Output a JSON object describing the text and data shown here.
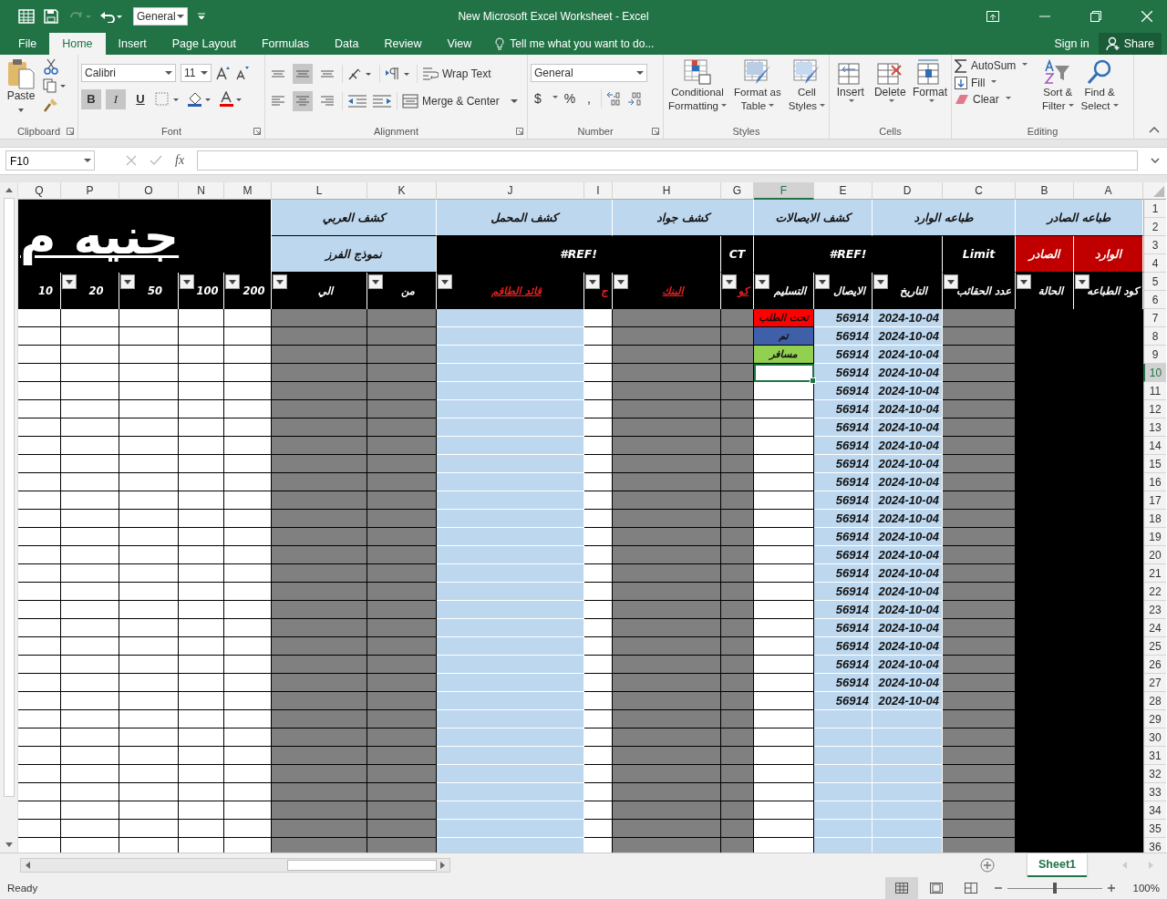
{
  "window": {
    "title": "New Microsoft Excel Worksheet - Excel",
    "quick_format": "General"
  },
  "ribbon": {
    "tabs": [
      {
        "label": "File",
        "selected": false
      },
      {
        "label": "Home",
        "selected": true
      },
      {
        "label": "Insert",
        "selected": false
      },
      {
        "label": "Page Layout",
        "selected": false
      },
      {
        "label": "Formulas",
        "selected": false
      },
      {
        "label": "Data",
        "selected": false
      },
      {
        "label": "Review",
        "selected": false
      },
      {
        "label": "View",
        "selected": false
      }
    ],
    "tell_me": "Tell me what you want to do...",
    "sign_in": "Sign in",
    "share": "Share",
    "clipboard": {
      "paste": "Paste",
      "label": "Clipboard"
    },
    "font": {
      "name": "Calibri",
      "size": "11",
      "label": "Font",
      "buttons": [
        {
          "label": "B",
          "selected": true
        },
        {
          "label": "I",
          "selected": true
        },
        {
          "label": "U",
          "selected": false
        }
      ]
    },
    "alignment": {
      "label": "Alignment",
      "wrap": "Wrap Text",
      "merge": "Merge & Center",
      "vertical": [
        {
          "selected": false
        },
        {
          "selected": true
        },
        {
          "selected": false
        }
      ],
      "horizontal": [
        {
          "selected": false
        },
        {
          "selected": true
        },
        {
          "selected": false
        }
      ]
    },
    "number": {
      "label": "Number",
      "format": "General",
      "currency": "$",
      "percent": "%",
      "comma": ","
    },
    "styles": {
      "label": "Styles",
      "buttons": [
        [
          "Conditional",
          "Formatting"
        ],
        [
          "Format as",
          "Table"
        ],
        [
          "Cell",
          "Styles"
        ]
      ]
    },
    "cells": {
      "label": "Cells",
      "buttons": [
        "Insert",
        "Delete",
        "Format"
      ]
    },
    "editing": {
      "label": "Editing",
      "autosum": "AutoSum",
      "fill": "Fill",
      "clear": "Clear",
      "sort": [
        "Sort &",
        "Filter"
      ],
      "find": [
        "Find &",
        "Select"
      ]
    }
  },
  "formula_bar": {
    "name_box": "F10",
    "fx": "fx"
  },
  "sheet": {
    "banner": "جنيه م",
    "report_headers": [
      "طباعه الصادر",
      "طباعه الوارد",
      "كشف الايصالات",
      "كشف جواد",
      "كشف المحمل",
      "كشف العربي"
    ],
    "subheaders": [
      {
        "text": "نموذج الفرز",
        "kind": "tinted"
      },
      {
        "text": "#REF!",
        "kind": "dark"
      },
      {
        "text": "CT",
        "kind": "dark"
      },
      {
        "text": "#REF!",
        "kind": "dark"
      },
      {
        "text": "Limit",
        "kind": "dark"
      },
      {
        "text": "الصادر",
        "kind": "alert"
      },
      {
        "text": "الوارد",
        "kind": "alert"
      }
    ],
    "column_letters": [
      {
        "letter": "Q",
        "selected": false
      },
      {
        "letter": "P",
        "selected": false
      },
      {
        "letter": "O",
        "selected": false
      },
      {
        "letter": "N",
        "selected": false
      },
      {
        "letter": "M",
        "selected": false
      },
      {
        "letter": "L",
        "selected": false
      },
      {
        "letter": "K",
        "selected": false
      },
      {
        "letter": "J",
        "selected": false
      },
      {
        "letter": "I",
        "selected": false
      },
      {
        "letter": "H",
        "selected": false
      },
      {
        "letter": "G",
        "selected": false
      },
      {
        "letter": "F",
        "selected": true
      },
      {
        "letter": "E",
        "selected": false
      },
      {
        "letter": "D",
        "selected": false
      },
      {
        "letter": "C",
        "selected": false
      },
      {
        "letter": "B",
        "selected": false
      },
      {
        "letter": "A",
        "selected": false
      }
    ],
    "columns": [
      {
        "kind": "dark",
        "title": "كود الطباعه",
        "link": false,
        "filter": true
      },
      {
        "kind": "dark",
        "title": "الحالة",
        "link": false,
        "filter": true
      },
      {
        "kind": "shaded",
        "title": "عدد الحقائب",
        "link": false,
        "filter": true
      },
      {
        "kind": "tinted",
        "title": "التاريخ",
        "link": false,
        "filter": true
      },
      {
        "kind": "tinted",
        "title": "الايصال",
        "link": false,
        "filter": true
      },
      {
        "kind": "blank",
        "title": "التسليم",
        "link": false,
        "filter": true
      },
      {
        "kind": "shaded",
        "title": "كو",
        "link": true,
        "filter": true
      },
      {
        "kind": "shaded",
        "title": "البنك",
        "link": true,
        "filter": true
      },
      {
        "kind": "blank",
        "title": "ج",
        "link": true,
        "filter": true
      },
      {
        "kind": "tinted",
        "title": "قائد الطاقم",
        "link": true,
        "filter": true
      },
      {
        "kind": "shaded",
        "title": "من",
        "link": false,
        "filter": true
      },
      {
        "kind": "shaded",
        "title": "الي",
        "link": false,
        "filter": true
      },
      {
        "kind": "blank",
        "title": "200",
        "link": false,
        "filter": true
      },
      {
        "kind": "blank",
        "title": "100",
        "link": false,
        "filter": true
      },
      {
        "kind": "blank",
        "title": "50",
        "link": false,
        "filter": true
      },
      {
        "kind": "blank",
        "title": "20",
        "link": false,
        "filter": true
      },
      {
        "kind": "blank",
        "title": "10",
        "link": false,
        "filter": false
      }
    ],
    "row_headers": [
      {
        "label": "1",
        "selected": false
      },
      {
        "label": "2",
        "selected": false
      },
      {
        "label": "3",
        "selected": false
      },
      {
        "label": "4",
        "selected": false
      },
      {
        "label": "5",
        "selected": false
      },
      {
        "label": "6",
        "selected": false
      },
      {
        "label": "7",
        "selected": false
      },
      {
        "label": "8",
        "selected": false
      },
      {
        "label": "9",
        "selected": false
      },
      {
        "label": "10",
        "selected": true
      },
      {
        "label": "11",
        "selected": false
      },
      {
        "label": "12",
        "selected": false
      },
      {
        "label": "13",
        "selected": false
      },
      {
        "label": "14",
        "selected": false
      },
      {
        "label": "15",
        "selected": false
      },
      {
        "label": "16",
        "selected": false
      },
      {
        "label": "17",
        "selected": false
      },
      {
        "label": "18",
        "selected": false
      },
      {
        "label": "19",
        "selected": false
      },
      {
        "label": "20",
        "selected": false
      },
      {
        "label": "21",
        "selected": false
      },
      {
        "label": "22",
        "selected": false
      },
      {
        "label": "23",
        "selected": false
      },
      {
        "label": "24",
        "selected": false
      },
      {
        "label": "25",
        "selected": false
      },
      {
        "label": "26",
        "selected": false
      },
      {
        "label": "27",
        "selected": false
      },
      {
        "label": "28",
        "selected": false
      },
      {
        "label": "29",
        "selected": false
      },
      {
        "label": "30",
        "selected": false
      },
      {
        "label": "31",
        "selected": false
      },
      {
        "label": "32",
        "selected": false
      },
      {
        "label": "33",
        "selected": false
      },
      {
        "label": "34",
        "selected": false
      },
      {
        "label": "35",
        "selected": false
      },
      {
        "label": "36",
        "selected": false
      }
    ],
    "rows": [
      {
        "status": {
          "text": "تحت الطلب",
          "color": "#ff0000"
        },
        "receipt": "56914",
        "date": "2024-10-04"
      },
      {
        "status": {
          "text": "تم",
          "color": "#3f5fa8"
        },
        "receipt": "56914",
        "date": "2024-10-04"
      },
      {
        "status": {
          "text": "مسافر",
          "color": "#92d050"
        },
        "receipt": "56914",
        "date": "2024-10-04"
      },
      {
        "receipt": "56914",
        "date": "2024-10-04"
      },
      {
        "receipt": "56914",
        "date": "2024-10-04"
      },
      {
        "receipt": "56914",
        "date": "2024-10-04"
      },
      {
        "receipt": "56914",
        "date": "2024-10-04"
      },
      {
        "receipt": "56914",
        "date": "2024-10-04"
      },
      {
        "receipt": "56914",
        "date": "2024-10-04"
      },
      {
        "receipt": "56914",
        "date": "2024-10-04"
      },
      {
        "receipt": "56914",
        "date": "2024-10-04"
      },
      {
        "receipt": "56914",
        "date": "2024-10-04"
      },
      {
        "receipt": "56914",
        "date": "2024-10-04"
      },
      {
        "receipt": "56914",
        "date": "2024-10-04"
      },
      {
        "receipt": "56914",
        "date": "2024-10-04"
      },
      {
        "receipt": "56914",
        "date": "2024-10-04"
      },
      {
        "receipt": "56914",
        "date": "2024-10-04"
      },
      {
        "receipt": "56914",
        "date": "2024-10-04"
      },
      {
        "receipt": "56914",
        "date": "2024-10-04"
      },
      {
        "receipt": "56914",
        "date": "2024-10-04"
      },
      {
        "receipt": "56914",
        "date": "2024-10-04"
      },
      {
        "receipt": "56914",
        "date": "2024-10-04"
      }
    ]
  },
  "sheet_tabs": [
    {
      "label": "Sheet1",
      "selected": true
    }
  ],
  "status_bar": {
    "text": "Ready",
    "views": [
      {
        "selected": true
      },
      {
        "selected": false
      },
      {
        "selected": false
      }
    ],
    "zoom": {
      "level": 0.5,
      "text": "100%"
    }
  }
}
